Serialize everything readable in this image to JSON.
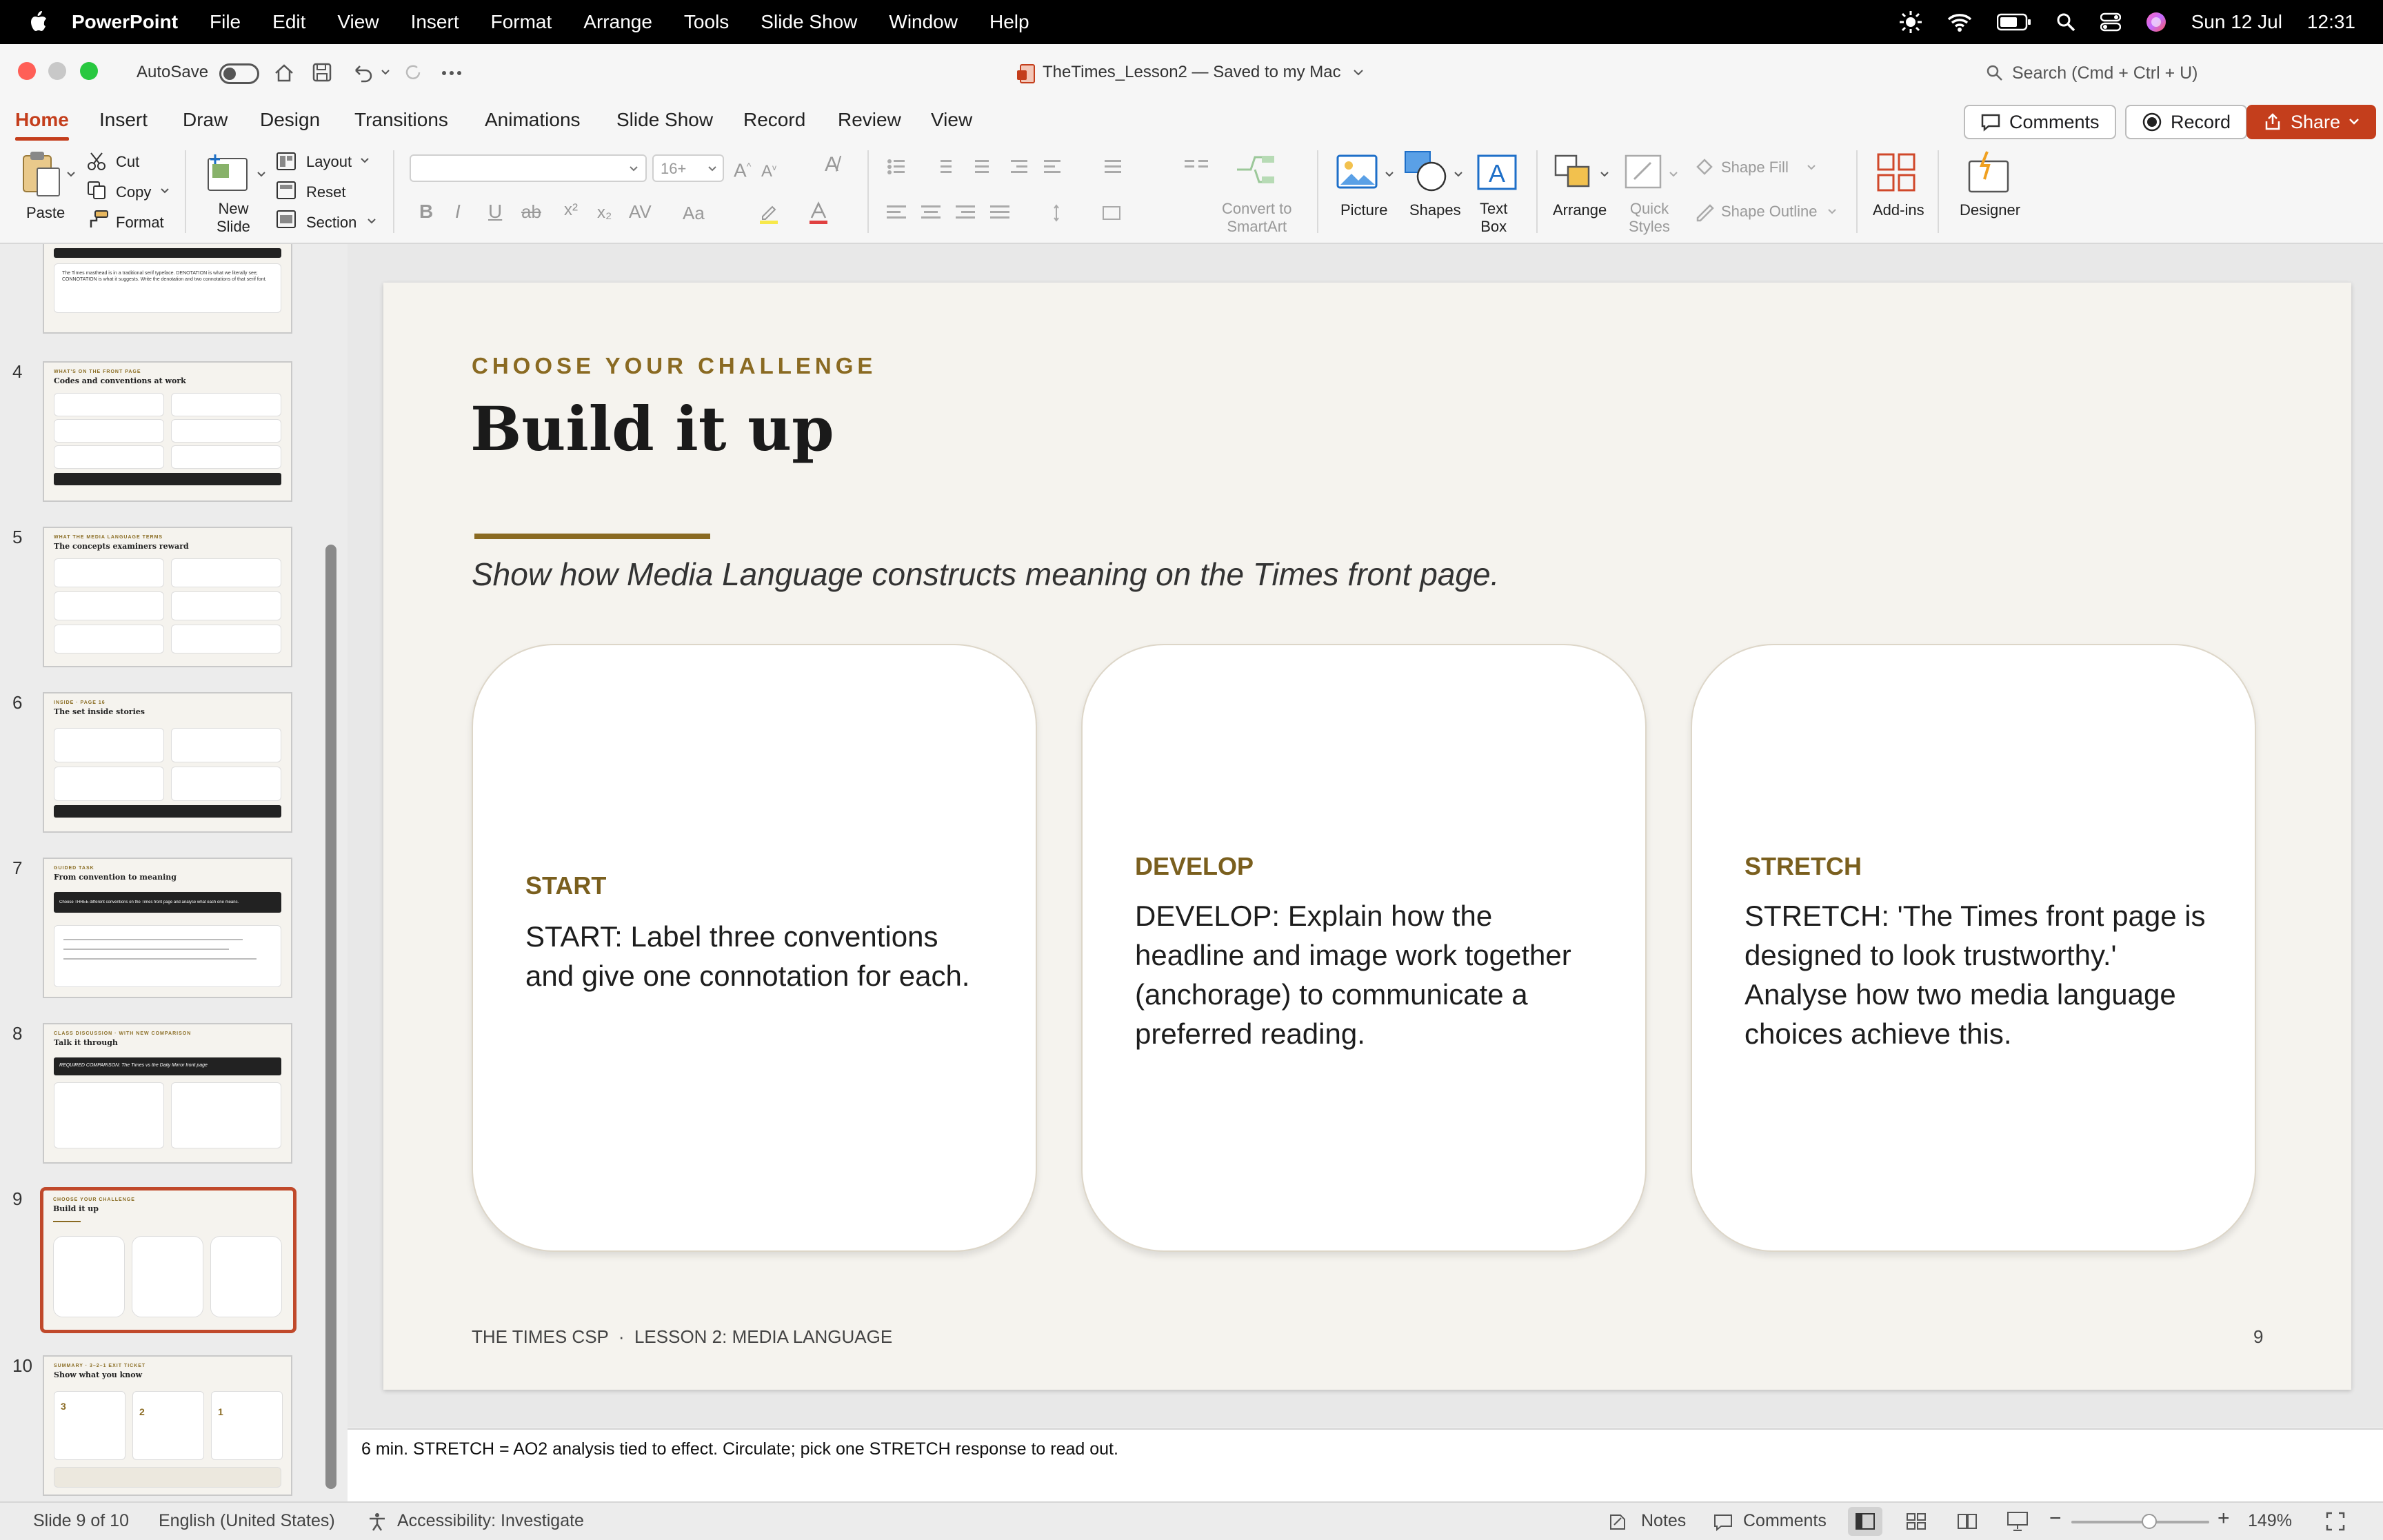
{
  "menubar": {
    "app_name": "PowerPoint",
    "items": [
      "File",
      "Edit",
      "View",
      "Insert",
      "Format",
      "Arrange",
      "Tools",
      "Slide Show",
      "Window",
      "Help"
    ],
    "date": "Sun 12 Jul",
    "time": "12:31"
  },
  "titlebar": {
    "autosave_label": "AutoSave",
    "doc_title": "TheTimes_Lesson2 — Saved to my Mac",
    "search_placeholder": "Search (Cmd + Ctrl + U)"
  },
  "ribbon_tabs": {
    "tabs": [
      "Home",
      "Insert",
      "Draw",
      "Design",
      "Transitions",
      "Animations",
      "Slide Show",
      "Record",
      "Review",
      "View"
    ],
    "comments_label": "Comments",
    "record_label": "Record",
    "share_label": "Share"
  },
  "ribbon": {
    "paste": "Paste",
    "cut": "Cut",
    "copy": "Copy",
    "format": "Format",
    "new_slide": "New\nSlide",
    "layout": "Layout",
    "reset": "Reset",
    "section": "Section",
    "font_size": "16+",
    "convert_smartart": "Convert to\nSmartArt",
    "picture": "Picture",
    "shapes": "Shapes",
    "text_box": "Text\nBox",
    "arrange": "Arrange",
    "quick_styles": "Quick\nStyles",
    "shape_fill": "Shape Fill",
    "shape_outline": "Shape Outline",
    "addins": "Add-ins",
    "designer": "Designer"
  },
  "thumbnails": {
    "numbers": [
      "4",
      "5",
      "6",
      "7",
      "8",
      "9",
      "10"
    ],
    "titles": [
      "Codes and conventions at work",
      "The concepts examiners reward",
      "The set inside stories",
      "From convention to meaning",
      "Talk it through",
      "Build it up",
      "Show what you know"
    ],
    "kickers": [
      "WHAT'S ON THE FRONT PAGE",
      "WHAT THE MEDIA LANGUAGE TERMS",
      "INSIDE · PAGE 16",
      "GUIDED TASK",
      "CLASS DISCUSSION · WITH NEW COMPARISON",
      "CHOOSE YOUR CHALLENGE",
      "SUMMARY · 3–2–1 EXIT TICKET"
    ],
    "slide8_banner": "REQUIRED COMPARISON: The Times vs the Daily Mirror front page",
    "slide7_banner": "Choose THREE different conventions on the Times front page and analyse what each one means.",
    "slide3_text": "The Times masthead is in a traditional serif typeface. DENOTATION is what we literally see; CONNOTATION is what it suggests. Write the denotation and two connotations of that serif font.",
    "slide10_nums": [
      "3",
      "2",
      "1"
    ]
  },
  "slide": {
    "kicker": "CHOOSE YOUR CHALLENGE",
    "title": "Build it up",
    "subtitle": "Show how Media Language constructs meaning on the Times front page.",
    "cards": [
      {
        "label": "START",
        "text": "START: Label three conventions and give one connotation for each."
      },
      {
        "label": "DEVELOP",
        "text": "DEVELOP: Explain how the headline and image work together (anchorage) to communicate a preferred reading."
      },
      {
        "label": "STRETCH",
        "text": "STRETCH: 'The Times front page is designed to look trustworthy.' Analyse how two media language choices achieve this."
      }
    ],
    "footer": "THE TIMES CSP  ·  LESSON 2: MEDIA LANGUAGE",
    "page_number": "9"
  },
  "notes": {
    "text": "6 min. STRETCH = AO2 analysis tied to effect. Circulate; pick one STRETCH response to read out."
  },
  "status": {
    "slide_count": "Slide 9 of 10",
    "language": "English (United States)",
    "accessibility": "Accessibility: Investigate",
    "notes": "Notes",
    "comments": "Comments",
    "zoom": "149%"
  },
  "colors": {
    "accent": "#c43e1c",
    "gold": "#8a6a22",
    "slide_bg": "#f5f3ee"
  }
}
